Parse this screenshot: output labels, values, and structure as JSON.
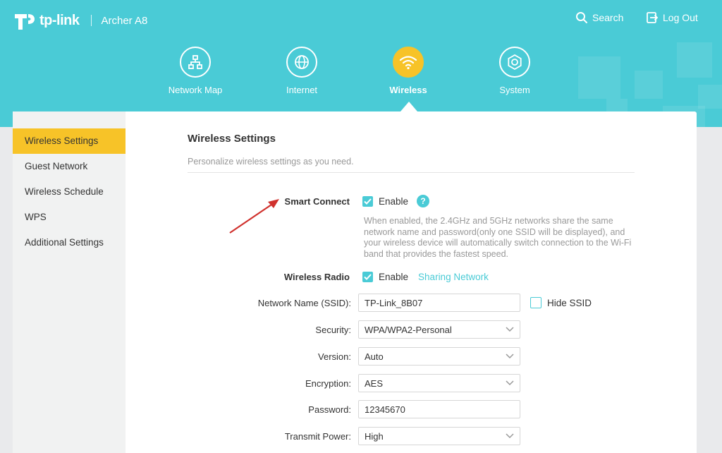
{
  "brand": {
    "logo_text": "tp-link",
    "model": "Archer A8"
  },
  "top_actions": {
    "search": "Search",
    "logout": "Log Out"
  },
  "nav": {
    "network_map": "Network Map",
    "internet": "Internet",
    "wireless": "Wireless",
    "system": "System",
    "active": "wireless"
  },
  "sidebar": {
    "items": [
      {
        "label": "Wireless Settings",
        "active": true
      },
      {
        "label": "Guest Network"
      },
      {
        "label": "Wireless Schedule"
      },
      {
        "label": "WPS"
      },
      {
        "label": "Additional Settings"
      }
    ]
  },
  "page": {
    "title": "Wireless Settings",
    "subtitle": "Personalize wireless settings as you need."
  },
  "smart_connect": {
    "label": "Smart Connect",
    "checkbox_label": "Enable",
    "checked": true,
    "help": "?",
    "note": "When enabled, the 2.4GHz and 5GHz networks share the same network name and password(only one SSID will be displayed), and your wireless device will automatically switch connection to the Wi-Fi band that provides the fastest speed."
  },
  "wireless_radio": {
    "label": "Wireless Radio",
    "checkbox_label": "Enable",
    "checked": true,
    "link": "Sharing Network"
  },
  "ssid": {
    "label": "Network Name (SSID):",
    "value": "TP-Link_8B07",
    "hide_label": "Hide SSID",
    "hide_checked": false
  },
  "security": {
    "label": "Security:",
    "value": "WPA/WPA2-Personal"
  },
  "version": {
    "label": "Version:",
    "value": "Auto"
  },
  "encryption": {
    "label": "Encryption:",
    "value": "AES"
  },
  "password": {
    "label": "Password:",
    "value": "12345670"
  },
  "transmit_power": {
    "label": "Transmit Power:",
    "value": "High"
  },
  "colors": {
    "accent": "#4acbd6",
    "active": "#f7c328",
    "annotation": "#d0312d"
  }
}
